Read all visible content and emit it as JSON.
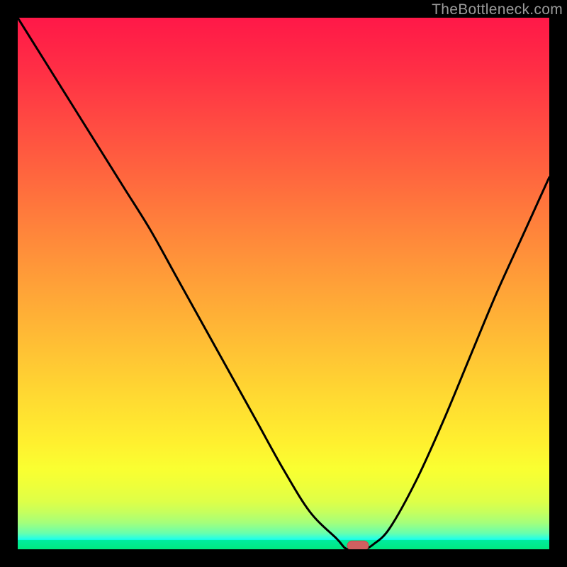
{
  "watermark": {
    "text": "TheBottleneck.com"
  },
  "colors": {
    "frame_bg": "#000000",
    "curve_stroke": "#000000",
    "marker_fill": "#d06060",
    "marker_stroke": "#c24f4f"
  },
  "chart_data": {
    "type": "line",
    "title": "",
    "xlabel": "",
    "ylabel": "",
    "xlim": [
      0,
      100
    ],
    "ylim": [
      0,
      100
    ],
    "grid": false,
    "series": [
      {
        "name": "bottleneck-curve",
        "x": [
          0,
          5,
          10,
          15,
          20,
          25,
          30,
          35,
          40,
          45,
          50,
          55,
          60,
          62,
          65,
          67,
          70,
          75,
          80,
          85,
          90,
          95,
          100
        ],
        "values": [
          100,
          92,
          84,
          76,
          68,
          60,
          51,
          42,
          33,
          24,
          15,
          7,
          2,
          0,
          0,
          1,
          4,
          13,
          24,
          36,
          48,
          59,
          70
        ]
      }
    ],
    "annotations": [
      {
        "type": "marker",
        "shape": "pill",
        "x_range": [
          62,
          66
        ],
        "y": 0.7
      }
    ],
    "background_gradient_stops": [
      {
        "pct": 0,
        "color": "#ff1848"
      },
      {
        "pct": 10,
        "color": "#ff2f45"
      },
      {
        "pct": 20,
        "color": "#ff4b42"
      },
      {
        "pct": 30,
        "color": "#ff673e"
      },
      {
        "pct": 40,
        "color": "#ff843b"
      },
      {
        "pct": 50,
        "color": "#ffa038"
      },
      {
        "pct": 60,
        "color": "#ffbb35"
      },
      {
        "pct": 70,
        "color": "#ffd632"
      },
      {
        "pct": 80,
        "color": "#fff02f"
      },
      {
        "pct": 85,
        "color": "#f9ff31"
      },
      {
        "pct": 88,
        "color": "#eeff3a"
      },
      {
        "pct": 91,
        "color": "#deff48"
      },
      {
        "pct": 93,
        "color": "#c6ff5d"
      },
      {
        "pct": 95,
        "color": "#a4ff7b"
      },
      {
        "pct": 97,
        "color": "#67ffae"
      },
      {
        "pct": 98.2,
        "color": "#1affef"
      },
      {
        "pct": 98.3,
        "color": "#00ec9e"
      },
      {
        "pct": 100,
        "color": "#00e87f"
      }
    ]
  }
}
